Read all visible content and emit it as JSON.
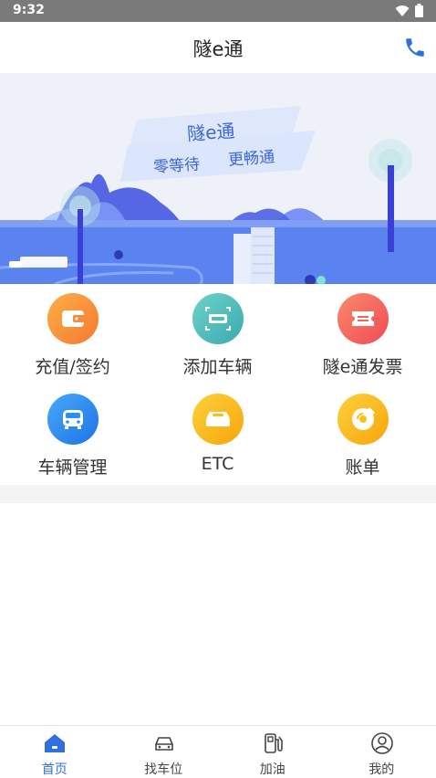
{
  "status_bar": {
    "time": "9:32"
  },
  "header": {
    "title": "隧e通"
  },
  "banner": {
    "title": "隧e通",
    "slogan_left": "零等待",
    "slogan_right": "更畅通"
  },
  "menu": {
    "items": [
      {
        "label": "充值/签约",
        "icon": "wallet-icon",
        "color": "#f98a3a"
      },
      {
        "label": "添加车辆",
        "icon": "plate-scan-icon",
        "color": "#4cbfb8"
      },
      {
        "label": "隧e通发票",
        "icon": "ticket-icon",
        "color": "#f6645c"
      },
      {
        "label": "车辆管理",
        "icon": "car-icon",
        "color": "#2d8cf0"
      },
      {
        "label": "ETC",
        "icon": "etc-device-icon",
        "color": "#fbbf16"
      },
      {
        "label": "账单",
        "icon": "bill-disc-icon",
        "color": "#fbbf16"
      }
    ]
  },
  "tabbar": {
    "tabs": [
      {
        "label": "首页",
        "icon": "home-icon",
        "active": true
      },
      {
        "label": "找车位",
        "icon": "car-outline-icon",
        "active": false
      },
      {
        "label": "加油",
        "icon": "fuel-pump-icon",
        "active": false
      },
      {
        "label": "我的",
        "icon": "profile-icon",
        "active": false
      }
    ]
  },
  "colors": {
    "accent": "#2f6fe0",
    "banner_sky": "#eef1f7",
    "banner_ground": "#5b83ef"
  }
}
